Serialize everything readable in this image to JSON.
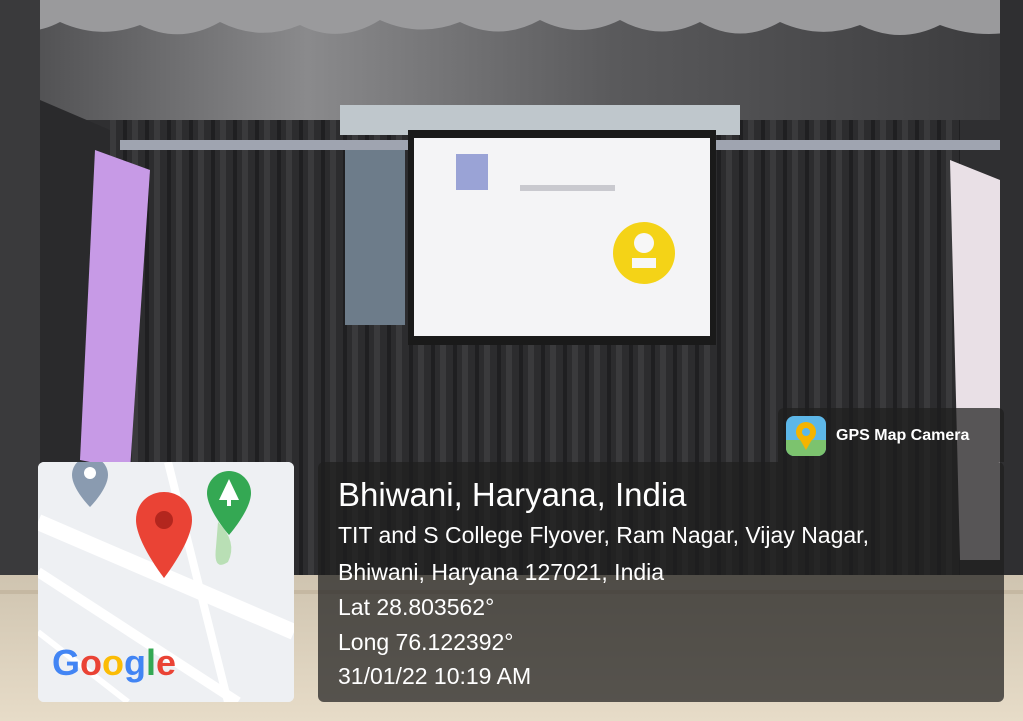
{
  "photo": {
    "subject": "stage-with-projection-screen"
  },
  "brand": {
    "label": "GPS Map Camera",
    "icon": "gps-map-camera-icon"
  },
  "map": {
    "logo_text": "Google",
    "pin_color": "#ea4335",
    "park_color": "#34a853"
  },
  "location": {
    "title": "Bhiwani, Haryana, India",
    "address_line1": "TIT and S College Flyover, Ram Nagar, Vijay Nagar,",
    "address_line2": "Bhiwani, Haryana 127021, India",
    "latitude": "Lat 28.803562°",
    "longitude": "Long 76.122392°",
    "datetime": "31/01/22 10:19 AM"
  }
}
